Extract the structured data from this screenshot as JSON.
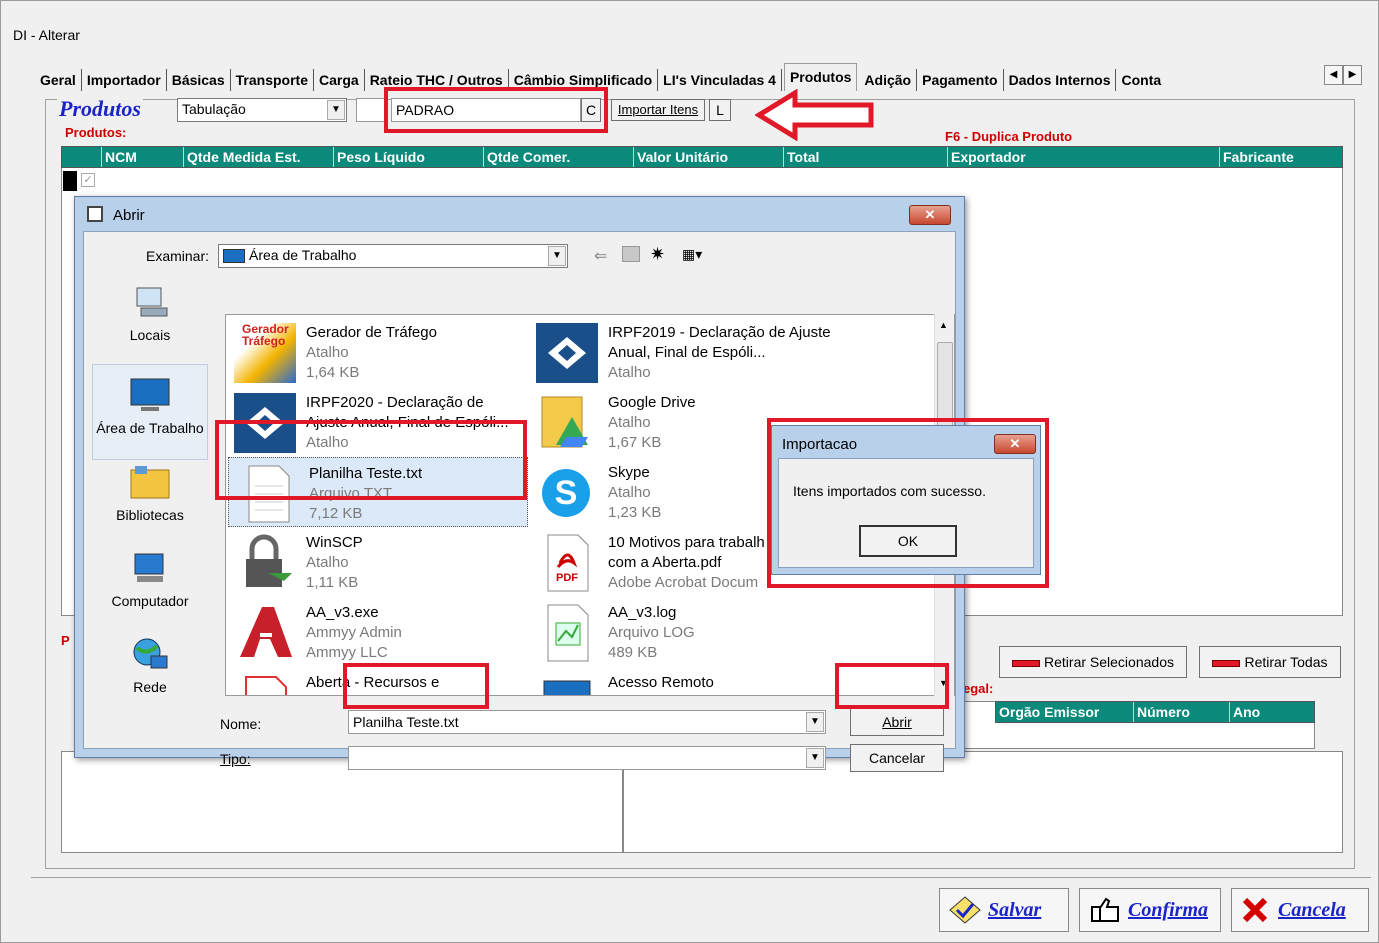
{
  "window": {
    "title": "DI - Alterar"
  },
  "tabs": [
    {
      "label": "Geral"
    },
    {
      "label": "Importador"
    },
    {
      "label": "Básicas"
    },
    {
      "label": "Transporte"
    },
    {
      "label": "Carga"
    },
    {
      "label": "Rateio THC / Outros"
    },
    {
      "label": "Câmbio Simplificado"
    },
    {
      "label": "LI's Vinculadas 4"
    },
    {
      "label": "Produtos",
      "active": true
    },
    {
      "label": "Adição"
    },
    {
      "label": "Pagamento"
    },
    {
      "label": "Dados Internos"
    },
    {
      "label": "Conta"
    }
  ],
  "produtos": {
    "legend": "Produtos",
    "sublabel": "Produtos:",
    "tabulacao_value": "Tabulação",
    "padrao_value": "PADRAO",
    "c_button": "C",
    "importar_button": "Importar Itens",
    "l_button": "L",
    "f6_hint": "F6 - Duplica Produto",
    "columns": [
      "NCM",
      "Qtde Medida Est.",
      "Peso Líquido",
      "Qtde Comer.",
      "Valor Unitário",
      "Total",
      "Exportador",
      "Fabricante"
    ]
  },
  "lower": {
    "retirar_sel": "Retirar Selecionados",
    "retirar_todas": "Retirar Todas",
    "legal_label": "egal:",
    "p_label": "P",
    "columns": [
      "Orgão Emissor",
      "Número",
      "Ano"
    ]
  },
  "abrir": {
    "title": "Abrir",
    "examinar_label": "Examinar:",
    "examinar_value": "Área de Trabalho",
    "places": [
      "Locais",
      "Área de Trabalho",
      "Bibliotecas",
      "Computador",
      "Rede"
    ],
    "files": [
      {
        "name": "Gerador de Tráfego",
        "type": "Atalho",
        "size": "1,64 KB",
        "icon_text": "Gerador Tráfego"
      },
      {
        "name": "IRPF2019 - Declaração de Ajuste Anual, Final de Espóli...",
        "type": "Atalho",
        "size": ""
      },
      {
        "name": "IRPF2020 - Declaração de Ajuste Anual, Final de Espóli...",
        "type": "Atalho",
        "size": ""
      },
      {
        "name": "Google Drive",
        "type": "Atalho",
        "size": "1,67 KB"
      },
      {
        "name": "Planilha Teste.txt",
        "type": "Arquivo TXT",
        "size": "7,12 KB"
      },
      {
        "name": "Skype",
        "type": "Atalho",
        "size": "1,23 KB",
        "icon_text": "S"
      },
      {
        "name": "WinSCP",
        "type": "Atalho",
        "size": "1,11 KB"
      },
      {
        "name": "10 Motivos para trabalh com a Aberta.pdf",
        "type": "Adobe Acrobat Docum",
        "size": "",
        "icon_text": "PDF"
      },
      {
        "name": "AA_v3.exe",
        "type": "Ammyy Admin",
        "size": "Ammyy LLC"
      },
      {
        "name": "AA_v3.log",
        "type": "Arquivo LOG",
        "size": "489 KB"
      },
      {
        "name": "Aberta - Recursos e",
        "type": "",
        "size": ""
      },
      {
        "name": "Acesso Remoto",
        "type": "",
        "size": ""
      }
    ],
    "nome_label": "Nome:",
    "nome_value": "Planilha Teste.txt",
    "tipo_label": "Tipo:",
    "tipo_value": "",
    "abrir_button": "Abrir",
    "cancelar_button": "Cancelar"
  },
  "importacao": {
    "title": "Importacao",
    "message": "Itens importados com sucesso.",
    "ok": "OK"
  },
  "footer": {
    "salvar": "Salvar",
    "confirma": "Confirma",
    "cancela": "Cancela"
  },
  "colors": {
    "accent_red": "#e01828",
    "grid_header": "#0b8a7c",
    "legend_blue": "#1a24c8"
  }
}
